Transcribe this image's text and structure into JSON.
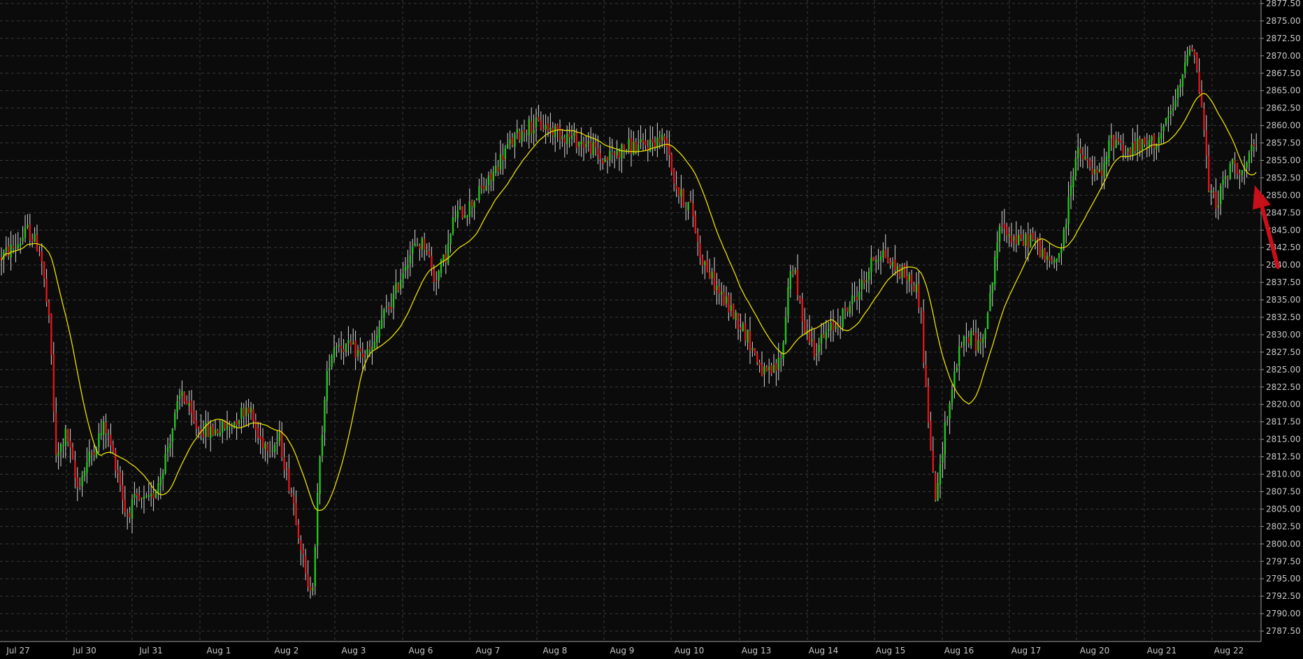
{
  "chart_data": {
    "type": "candlestick",
    "title": "",
    "xlabel": "",
    "ylabel": "",
    "ylim": [
      2786.0,
      2878.0
    ],
    "grid": true,
    "colors": {
      "background": "#000000",
      "plot_background": "#0b0b0b",
      "grid": "#3a3a3a",
      "axis": "#9a9a9a",
      "tick_label": "#c8c8c8",
      "up_candle": "#22c41e",
      "down_candle": "#e0141a",
      "wick": "#d8d8d8",
      "moving_average": "#e8e000",
      "annotation_arrow": "#c8101a"
    },
    "y_ticks": [
      2787.5,
      2790.0,
      2792.5,
      2795.0,
      2797.5,
      2800.0,
      2802.5,
      2805.0,
      2807.5,
      2810.0,
      2812.5,
      2815.0,
      2817.5,
      2820.0,
      2822.5,
      2825.0,
      2827.5,
      2830.0,
      2832.5,
      2835.0,
      2837.5,
      2840.0,
      2842.5,
      2845.0,
      2847.5,
      2850.0,
      2852.5,
      2855.0,
      2857.5,
      2860.0,
      2862.5,
      2865.0,
      2867.5,
      2870.0,
      2872.5,
      2875.0,
      2877.5
    ],
    "x_ticks": [
      "Jul 27",
      "Jul 30",
      "Jul 31",
      "Aug 1",
      "Aug 2",
      "Aug 3",
      "Aug 6",
      "Aug 7",
      "Aug 8",
      "Aug 9",
      "Aug 10",
      "Aug 13",
      "Aug 14",
      "Aug 15",
      "Aug 16",
      "Aug 17",
      "Aug 20",
      "Aug 21",
      "Aug 22"
    ],
    "session_close": [
      2842.0,
      2812.0,
      2805.0,
      2816.0,
      2793.0,
      2828.0,
      2840.0,
      2860.0,
      2858.0,
      2857.0,
      2849.0,
      2823.0,
      2831.0,
      2837.0,
      2813.0,
      2832.0,
      2852.0,
      2858.0,
      2857.0
    ],
    "key_levels": {
      "session_high": 2874.0,
      "session_low": 2791.5
    },
    "series": [
      {
        "type": "candlestick"
      },
      {
        "type": "moving_average"
      }
    ],
    "annotations": [
      {
        "type": "arrow"
      }
    ]
  }
}
